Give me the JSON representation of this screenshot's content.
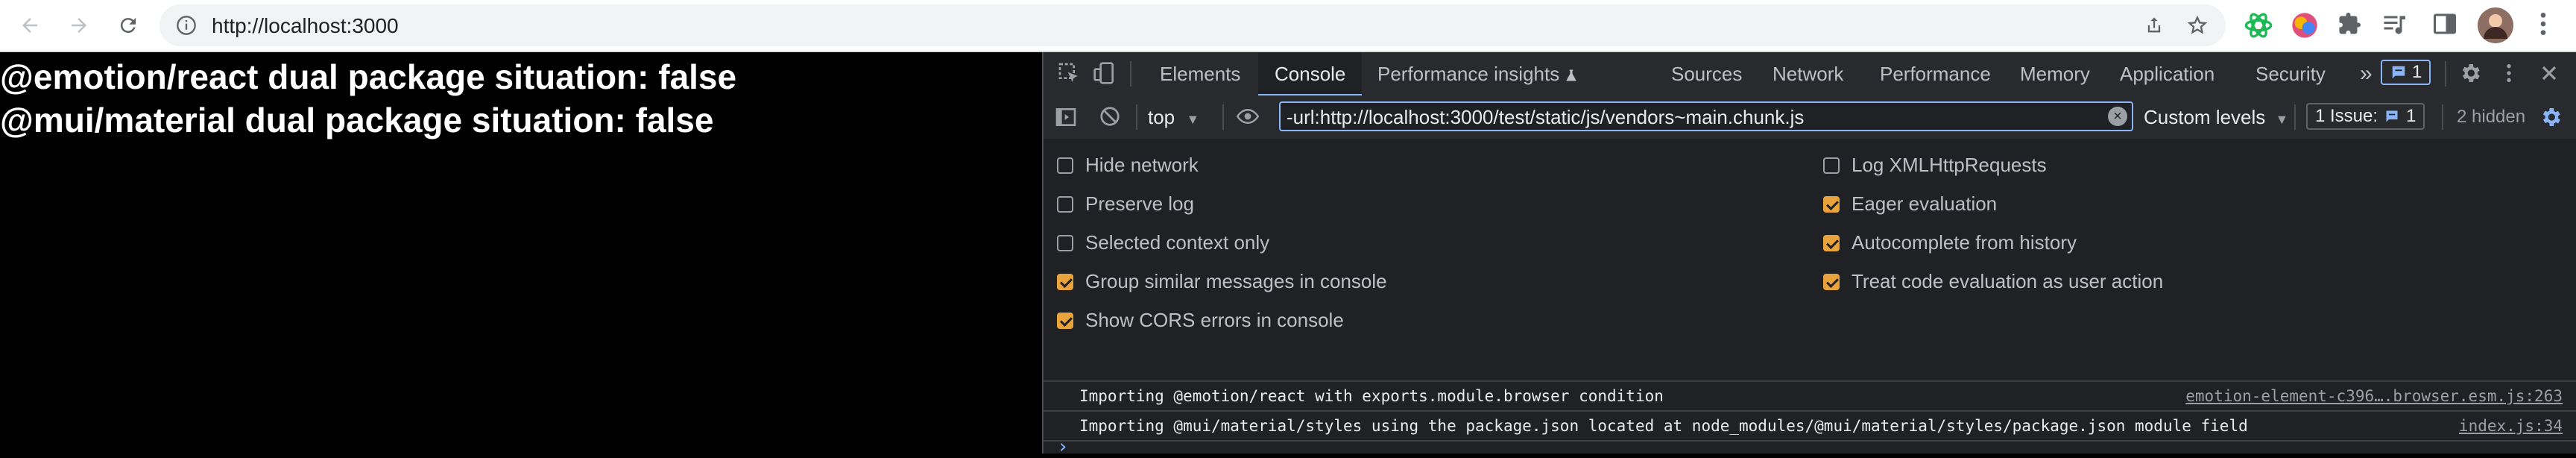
{
  "browser": {
    "url": "http://localhost:3000",
    "nav": {
      "back_icon": "arrow-left-icon",
      "forward_icon": "arrow-right-icon",
      "reload_icon": "reload-icon",
      "info_icon": "info-icon"
    }
  },
  "page": {
    "lines": [
      "@emotion/react dual package situation: false",
      "@mui/material dual package situation: false"
    ]
  },
  "devtools": {
    "tabs": [
      {
        "label": "Elements"
      },
      {
        "label": "Console"
      },
      {
        "label": "Performance insights"
      },
      {
        "label": "Sources"
      },
      {
        "label": "Network"
      },
      {
        "label": "Performance"
      },
      {
        "label": "Memory"
      },
      {
        "label": "Application"
      },
      {
        "label": "Security"
      }
    ],
    "active_tab": "Console",
    "more_tabs": "»",
    "messages_badge_count": "1",
    "context": "top",
    "filter_value": "-url:http://localhost:3000/test/static/js/vendors~main.chunk.js",
    "levels_label": "Custom levels",
    "issues_label": "1 Issue:",
    "issues_count": "1",
    "hidden_label": "2 hidden",
    "settings": {
      "left": [
        {
          "label": "Hide network",
          "checked": false
        },
        {
          "label": "Preserve log",
          "checked": false
        },
        {
          "label": "Selected context only",
          "checked": false
        },
        {
          "label": "Group similar messages in console",
          "checked": true
        },
        {
          "label": "Show CORS errors in console",
          "checked": true
        }
      ],
      "right": [
        {
          "label": "Log XMLHttpRequests",
          "checked": false
        },
        {
          "label": "Eager evaluation",
          "checked": true
        },
        {
          "label": "Autocomplete from history",
          "checked": true
        },
        {
          "label": "Treat code evaluation as user action",
          "checked": true
        }
      ]
    },
    "messages": [
      {
        "text": "Importing @emotion/react with exports.module.browser condition",
        "source": "emotion-element-c396….browser.esm.js:263"
      },
      {
        "text": "Importing @mui/material/styles using the package.json located at node_modules/@mui/material/styles/package.json module field",
        "source": "index.js:34"
      }
    ],
    "prompt_symbol": "›"
  },
  "colors": {
    "accent": "#8ab4f8",
    "checkbox": "#e8a33d",
    "devtools_bg": "#202124"
  }
}
